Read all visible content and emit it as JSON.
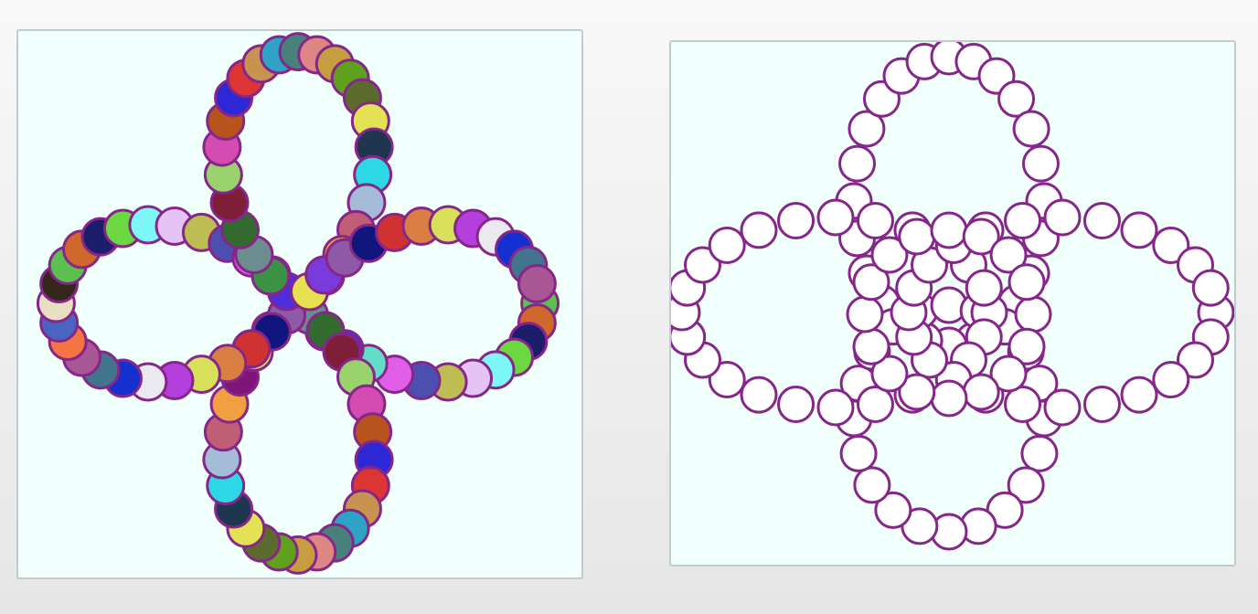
{
  "stroke_color": "#86268a",
  "left_fill_palette": [
    "#5cbf4f",
    "#d0672c",
    "#1c1d6b",
    "#6bd842",
    "#7df7f8",
    "#e5c3f5",
    "#bdbd53",
    "#4d4fb0",
    "#e05ee8",
    "#63ddc8",
    "#4f2ddb",
    "#3b9245",
    "#6c8c8f",
    "#326a30",
    "#7e1e39",
    "#9ad26e",
    "#d44bb2",
    "#b7541d",
    "#2e27d5",
    "#dd3434",
    "#c69450",
    "#2fa3c6",
    "#48817b",
    "#de8684",
    "#c69d41",
    "#5fa11c",
    "#5d6a2d",
    "#e2e254",
    "#1f3651",
    "#2cd8e4",
    "#a5bcd9",
    "#c05e75",
    "#f1a041",
    "#7f1479",
    "#e7e050",
    "#7a3bdd",
    "#8e5aa8",
    "#10167b",
    "#d03131",
    "#da7f43",
    "#d8e05a",
    "#b43fdc",
    "#eae9f0",
    "#1530d0",
    "#42748e",
    "#a95694",
    "#f57444",
    "#4a64c1",
    "#e9dfc0",
    "#35271c"
  ],
  "right_fill": "#ffffff"
}
